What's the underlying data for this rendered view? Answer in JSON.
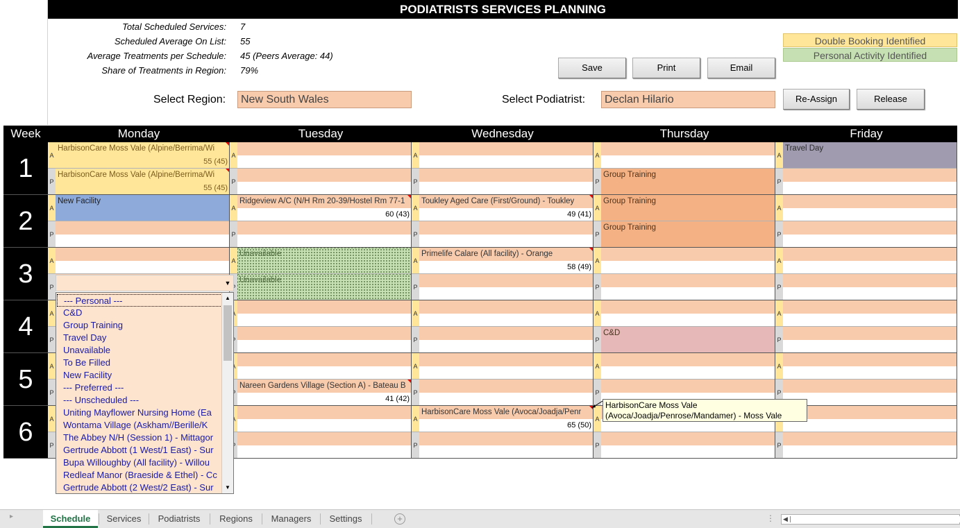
{
  "title": "PODIATRISTS SERVICES PLANNING",
  "stats": [
    {
      "label": "Total Scheduled Services:",
      "value": "7"
    },
    {
      "label": "Scheduled Average On List:",
      "value": "55"
    },
    {
      "label": "Average Treatments per Schedule:",
      "value": "45 (Peers Average: 44)"
    },
    {
      "label": "Share of Treatments in Region:",
      "value": "79%"
    }
  ],
  "legend": {
    "double_booking": "Double Booking Identified",
    "personal_activity": "Personal Activity Identified",
    "colors": {
      "double_booking": "#ffe699",
      "personal_activity": "#c6e0b4"
    }
  },
  "buttons": {
    "save": "Save",
    "print": "Print",
    "email": "Email",
    "reassign": "Re-Assign",
    "release": "Release"
  },
  "selectors": {
    "region_label": "Select Region:",
    "region_value": "New South Wales",
    "podiatrist_label": "Select Podiatrist:",
    "podiatrist_value": "Declan Hilario"
  },
  "grid": {
    "week_header": "Week",
    "days": [
      "Monday",
      "Tuesday",
      "Wednesday",
      "Thursday",
      "Friday"
    ],
    "weeks": [
      "1",
      "2",
      "3",
      "4",
      "5",
      "6"
    ],
    "slot_labels": {
      "am": "A",
      "pm": "P"
    },
    "entries": {
      "mon_w1_a": {
        "text": "HarbisonCare Moss Vale (Alpine/Berrima/Wi",
        "count": "55 (45)"
      },
      "mon_w1_p": {
        "text": "HarbisonCare Moss Vale (Alpine/Berrima/Wi",
        "count": "55 (45)"
      },
      "mon_w2_a": {
        "text": "New Facility"
      },
      "tue_w2_a": {
        "text": "Ridgeview A/C (N/H Rm 20-39/Hostel Rm 77-1",
        "count": "60 (43)"
      },
      "tue_w3_a": {
        "text": "Unavailable"
      },
      "tue_w3_p": {
        "text": "Unavailable"
      },
      "tue_w5_p": {
        "text": "Nareen Gardens Village (Section A) - Bateau B",
        "count": "41 (42)"
      },
      "wed_w2_a": {
        "text": "Toukley Aged Care (First/Ground) - Toukley",
        "count": "49 (41)"
      },
      "wed_w3_a": {
        "text": "Primelife Calare (All facility) - Orange",
        "count": "58 (49)"
      },
      "wed_w6_a": {
        "text": "HarbisonCare Moss Vale (Avoca/Joadja/Penr",
        "count": "65 (50)"
      },
      "thu_w1_p": {
        "text": "Group Training"
      },
      "thu_w2_a": {
        "text": "Group Training"
      },
      "thu_w2_p": {
        "text": "Group Training"
      },
      "thu_w4_p": {
        "text": "C&D"
      },
      "fri_w1_a": {
        "text": "Travel Day"
      }
    }
  },
  "dropdown": {
    "items": [
      "--- Personal ---",
      "C&D",
      "Group Training",
      "Travel Day",
      "Unavailable",
      "To Be Filled",
      "New Facility",
      "--- Preferred ---",
      "--- Unscheduled ---",
      "Uniting Mayflower Nursing Home (Ea",
      "Wontama Village (Askham//Berille/K",
      "The Abbey N/H (Session 1) - Mittagor",
      "Gertrude Abbott (1 West/1 East) - Sur",
      "Bupa Willoughby (All facility) - Willou",
      "Redleaf Manor (Braeside & Ethel) - Cc",
      "Gertrude Abbott (2 West/2 East) - Sur"
    ]
  },
  "tooltip": {
    "line1": "HarbisonCare Moss Vale",
    "line2": "(Avoca/Joadja/Penrose/Mandamer) - Moss Vale"
  },
  "tabs": [
    "Schedule",
    "Services",
    "Podiatrists",
    "Regions",
    "Managers",
    "Settings"
  ],
  "active_tab": "Schedule"
}
